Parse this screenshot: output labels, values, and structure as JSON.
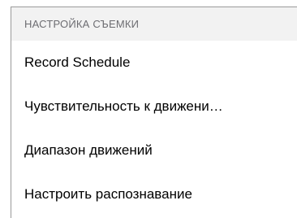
{
  "section": {
    "header": "НАСТРОЙКА СЪЕМКИ",
    "items": [
      {
        "label": "Record Schedule"
      },
      {
        "label": "Чувствительность к движени…"
      },
      {
        "label": "Диапазон движений"
      },
      {
        "label": "Настроить распознавание"
      }
    ]
  },
  "colors": {
    "header_background": "#f2f2f2",
    "header_text": "#6d6d72",
    "item_text": "#000000",
    "border": "#9a9a9a"
  }
}
